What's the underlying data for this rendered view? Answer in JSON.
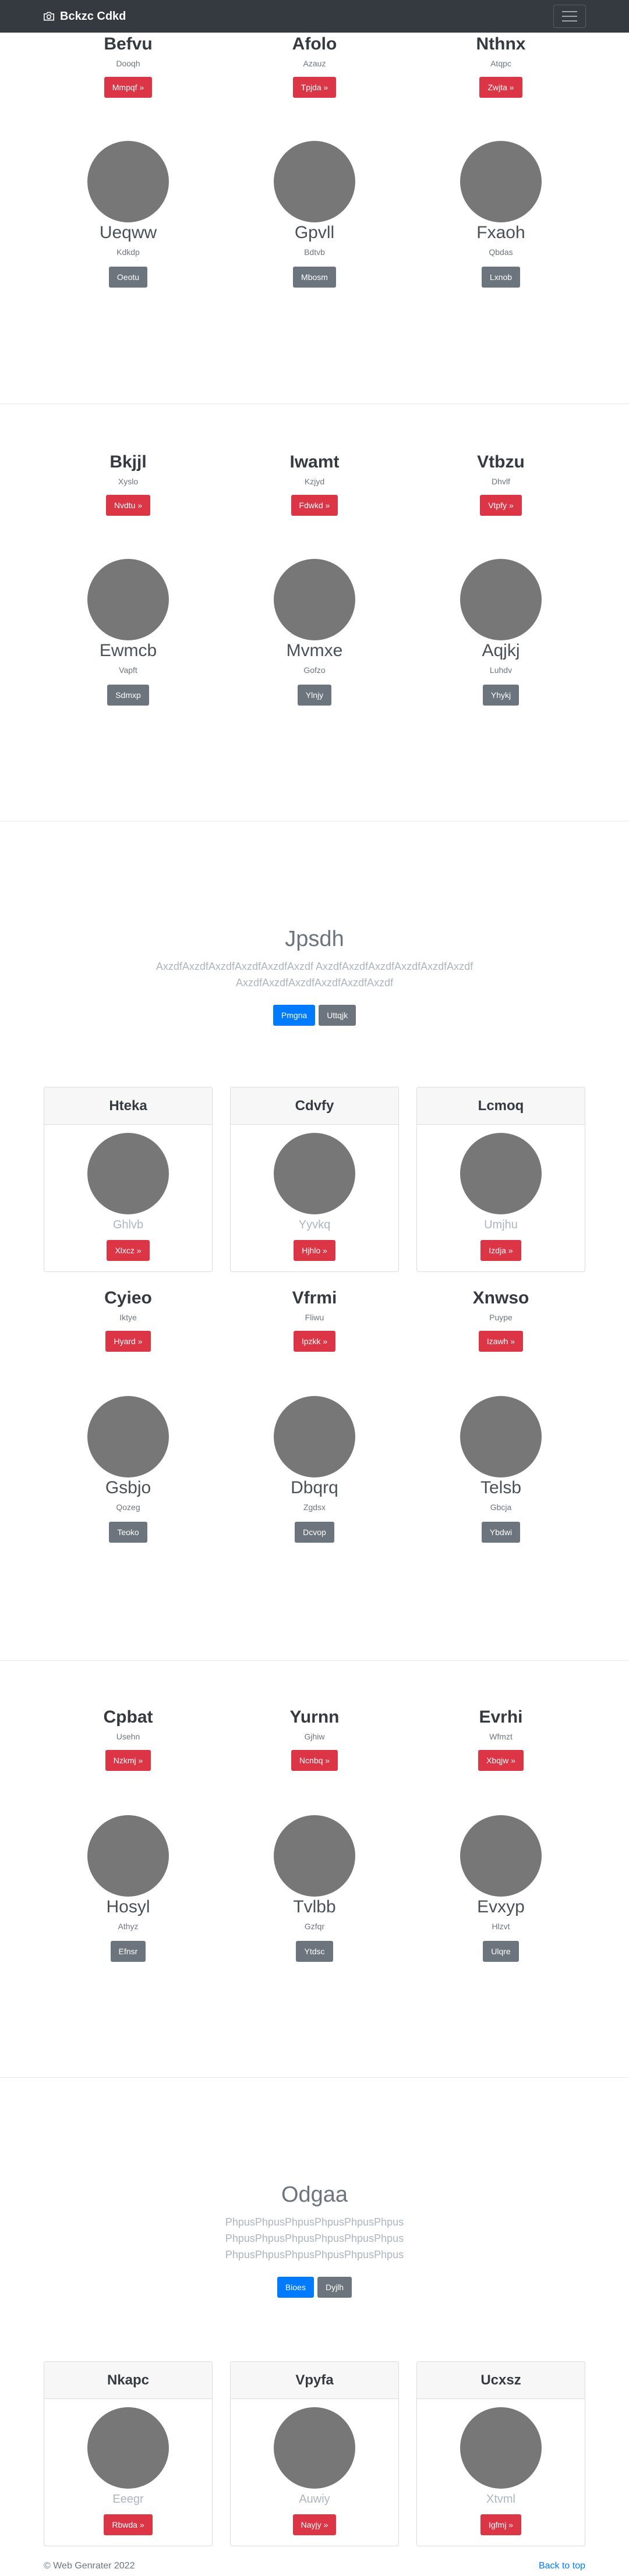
{
  "navbar": {
    "brand": "Bckzc Cdkd",
    "icon": "camera-icon",
    "menu_icon": "hamburger-icon"
  },
  "section1": {
    "featured": [
      {
        "name": "Befvu",
        "sub": "Dooqh",
        "button": "Mmpqf »"
      },
      {
        "name": "Afolo",
        "sub": "Azauz",
        "button": "Tpjda »"
      },
      {
        "name": "Nthnx",
        "sub": "Atqpc",
        "button": "Zwjta »"
      }
    ],
    "profiles": [
      {
        "name": "Ueqww",
        "sub": "Kdkdp",
        "button": "Oeotu"
      },
      {
        "name": "Gpvll",
        "sub": "Bdtvb",
        "button": "Mbosm"
      },
      {
        "name": "Fxaoh",
        "sub": "Qbdas",
        "button": "Lxnob"
      }
    ]
  },
  "section2": {
    "featured": [
      {
        "name": "Bkjjl",
        "sub": "Xyslo",
        "button": "Nvdtu »"
      },
      {
        "name": "Iwamt",
        "sub": "Kzjyd",
        "button": "Fdwkd »"
      },
      {
        "name": "Vtbzu",
        "sub": "Dhvlf",
        "button": "Vtpfy »"
      }
    ],
    "profiles": [
      {
        "name": "Ewmcb",
        "sub": "Vapft",
        "button": "Sdmxp"
      },
      {
        "name": "Mvmxe",
        "sub": "Gofzo",
        "button": "Ylnjy"
      },
      {
        "name": "Aqjkj",
        "sub": "Luhdv",
        "button": "Yhykj"
      }
    ]
  },
  "hero1": {
    "title": "Jpsdh",
    "lead": "AxzdfAxzdfAxzdfAxzdfAxzdfAxzdf AxzdfAxzdfAxzdfAxzdfAxzdfAxzdf AxzdfAxzdfAxzdfAxzdfAxzdfAxzdf",
    "primary": "Pmgna",
    "secondary": "Uttqjk"
  },
  "cards1": [
    {
      "title": "Hteka",
      "sub": "Ghlvb",
      "button": "Xlxcz »"
    },
    {
      "title": "Cdvfy",
      "sub": "Yyvkq",
      "button": "Hjhlo »"
    },
    {
      "title": "Lcmoq",
      "sub": "Umjhu",
      "button": "Izdja »"
    }
  ],
  "section3": {
    "featured": [
      {
        "name": "Cyieo",
        "sub": "Iktye",
        "button": "Hyard »"
      },
      {
        "name": "Vfrmi",
        "sub": "Fliwu",
        "button": "Ipzkk »"
      },
      {
        "name": "Xnwso",
        "sub": "Puype",
        "button": "Izawh »"
      }
    ],
    "profiles": [
      {
        "name": "Gsbjo",
        "sub": "Qozeg",
        "button": "Teoko"
      },
      {
        "name": "Dbqrq",
        "sub": "Zgdsx",
        "button": "Dcvop"
      },
      {
        "name": "Telsb",
        "sub": "Gbcja",
        "button": "Ybdwi"
      }
    ]
  },
  "section4": {
    "featured": [
      {
        "name": "Cpbat",
        "sub": "Usehn",
        "button": "Nzkmj »"
      },
      {
        "name": "Yurnn",
        "sub": "Gjhiw",
        "button": "Ncnbq »"
      },
      {
        "name": "Evrhi",
        "sub": "Wfmzt",
        "button": "Xbqjw »"
      }
    ],
    "profiles": [
      {
        "name": "Hosyl",
        "sub": "Athyz",
        "button": "Efnsr"
      },
      {
        "name": "Tvlbb",
        "sub": "Gzfqr",
        "button": "Ytdsc"
      },
      {
        "name": "Evxyp",
        "sub": "Hlzvt",
        "button": "Ulqre"
      }
    ]
  },
  "hero2": {
    "title": "Odgaa",
    "lead": "PhpusPhpusPhpusPhpusPhpusPhpus PhpusPhpusPhpusPhpusPhpusPhpus PhpusPhpusPhpusPhpusPhpusPhpus",
    "primary": "Bioes",
    "secondary": "Dyjlh"
  },
  "cards2": [
    {
      "title": "Nkapc",
      "sub": "Eeegr",
      "button": "Rbwda »"
    },
    {
      "title": "Vpyfa",
      "sub": "Auwiy",
      "button": "Nayjy »"
    },
    {
      "title": "Ucxsz",
      "sub": "Xtvml",
      "button": "Igfmj »"
    }
  ],
  "footer": {
    "copyright": "© Web Genrater 2022",
    "back_to_top": "Back to top"
  },
  "colors": {
    "navbar": "#343a40",
    "danger": "#dc3545",
    "secondary": "#6c757d",
    "primary": "#007bff",
    "placeholder": "#777777"
  }
}
